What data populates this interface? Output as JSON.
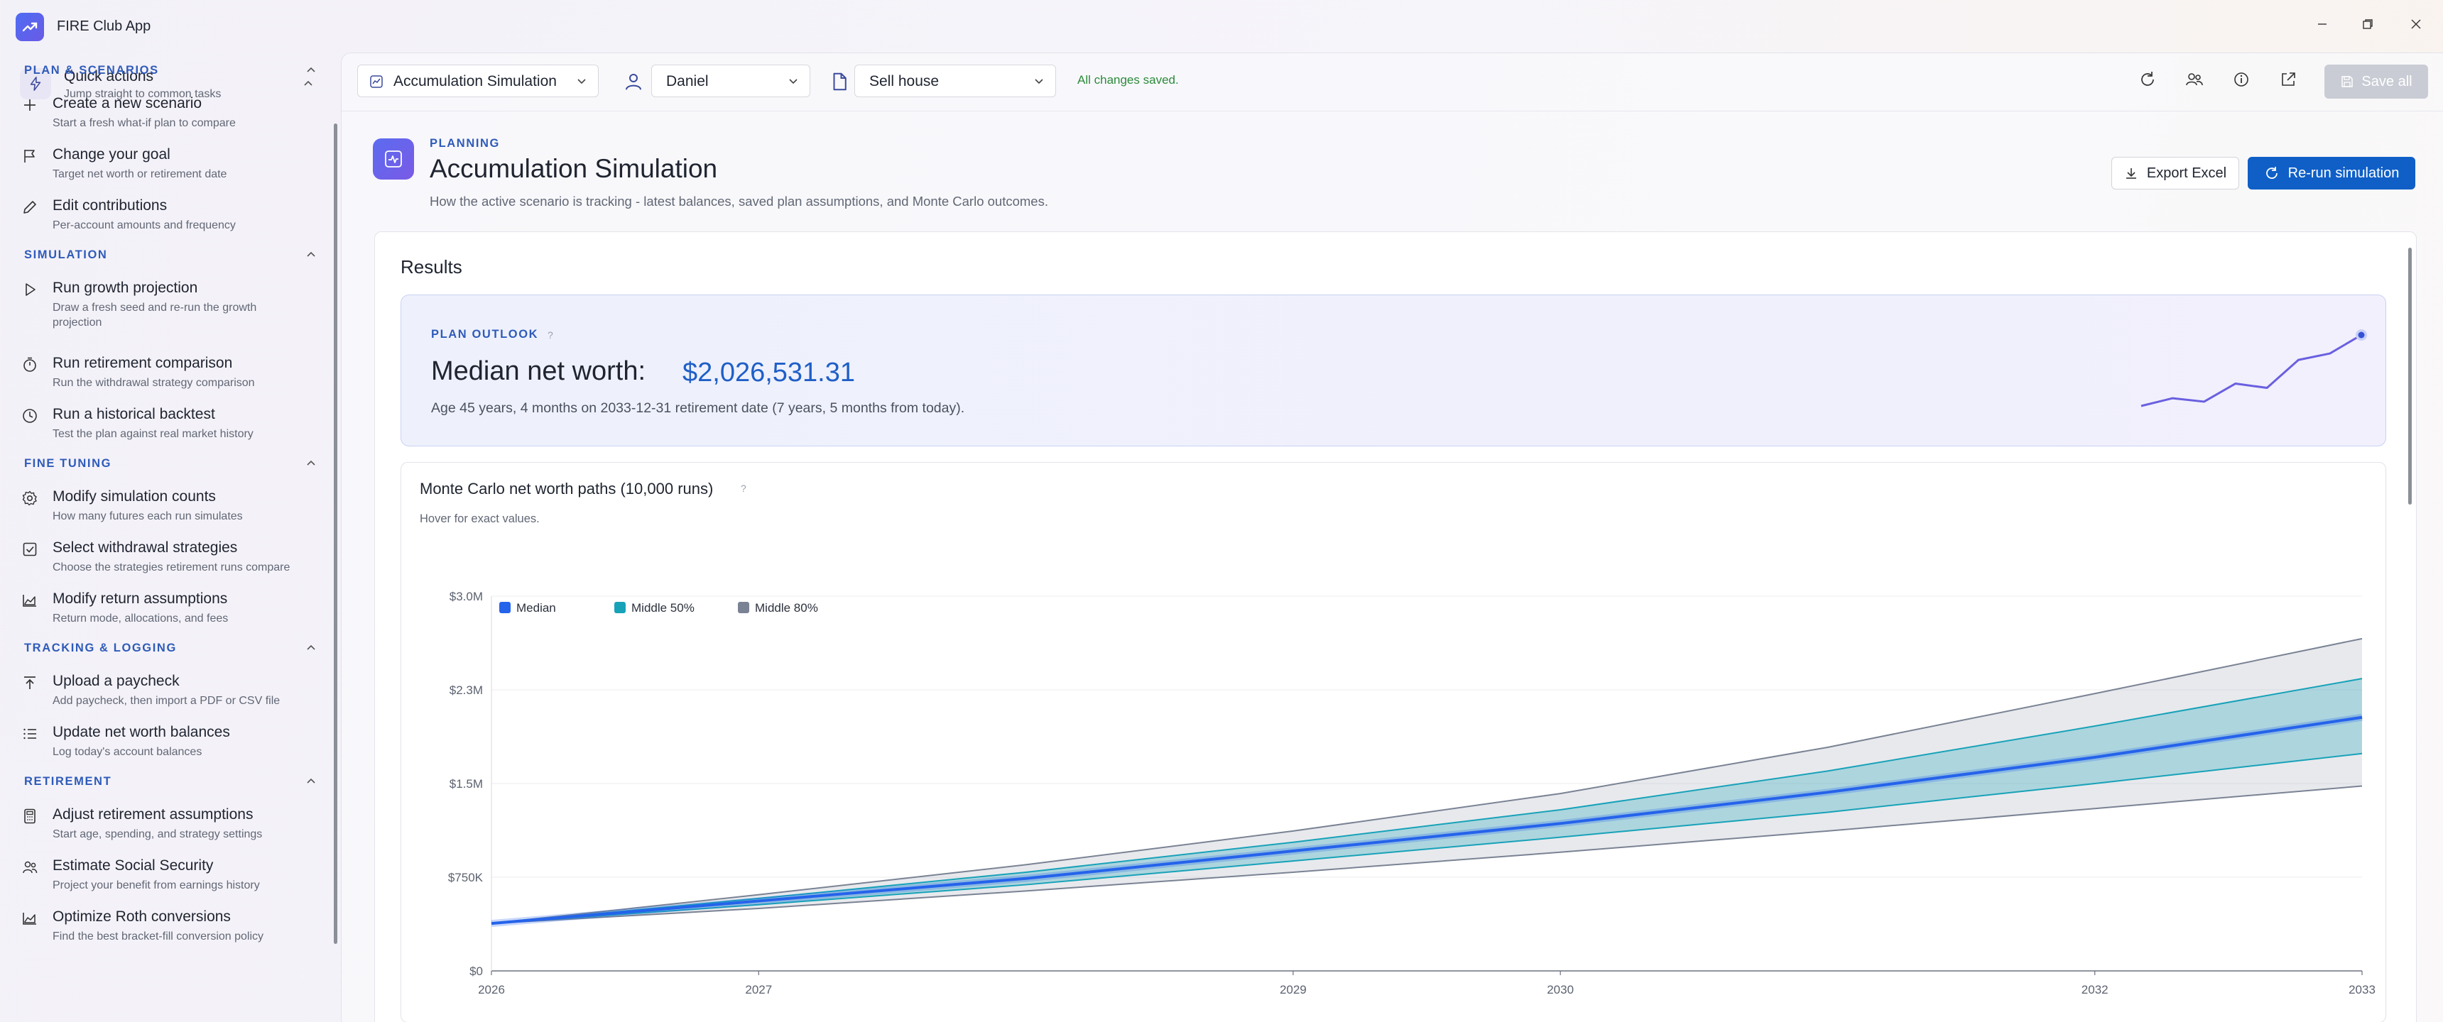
{
  "app": {
    "title": "FIRE Club App"
  },
  "sidebar": {
    "quick_actions": {
      "title": "Quick actions",
      "subtitle": "Jump straight to common tasks"
    },
    "sections": [
      {
        "heading": "PLAN & SCENARIOS",
        "items": [
          {
            "title": "Create a new scenario",
            "subtitle": "Start a fresh what-if plan to compare",
            "icon": "plus-icon"
          },
          {
            "title": "Change your goal",
            "subtitle": "Target net worth or retirement date",
            "icon": "flag-icon"
          },
          {
            "title": "Edit contributions",
            "subtitle": "Per-account amounts and frequency",
            "icon": "pencil-icon"
          }
        ]
      },
      {
        "heading": "SIMULATION",
        "items": [
          {
            "title": "Run growth projection",
            "subtitle": "Draw a fresh seed and re-run the growth projection",
            "icon": "play-icon"
          },
          {
            "title": "Run retirement comparison",
            "subtitle": "Run the withdrawal strategy comparison",
            "icon": "timer-icon"
          },
          {
            "title": "Run a historical backtest",
            "subtitle": "Test the plan against real market history",
            "icon": "clock-icon"
          }
        ]
      },
      {
        "heading": "FINE TUNING",
        "items": [
          {
            "title": "Modify simulation counts",
            "subtitle": "How many futures each run simulates",
            "icon": "gear-icon"
          },
          {
            "title": "Select withdrawal strategies",
            "subtitle": "Choose the strategies retirement runs compare",
            "icon": "checkbox-icon"
          },
          {
            "title": "Modify return assumptions",
            "subtitle": "Return mode, allocations, and fees",
            "icon": "area-chart-icon"
          }
        ]
      },
      {
        "heading": "TRACKING & LOGGING",
        "items": [
          {
            "title": "Upload a paycheck",
            "subtitle": "Add paycheck, then import a PDF or CSV file",
            "icon": "upload-icon"
          },
          {
            "title": "Update net worth balances",
            "subtitle": "Log today's account balances",
            "icon": "list-icon"
          }
        ]
      },
      {
        "heading": "RETIREMENT",
        "items": [
          {
            "title": "Adjust retirement assumptions",
            "subtitle": "Start age, spending, and strategy settings",
            "icon": "calculator-icon"
          },
          {
            "title": "Estimate Social Security",
            "subtitle": "Project your benefit from earnings history",
            "icon": "people-icon"
          },
          {
            "title": "Optimize Roth conversions",
            "subtitle": "Find the best bracket-fill conversion policy",
            "icon": "area-chart-icon"
          }
        ]
      }
    ]
  },
  "toolbar": {
    "view": "Accumulation Simulation",
    "person": "Daniel",
    "scenario": "Sell house",
    "status": "All changes saved.",
    "save_all": "Save all"
  },
  "header": {
    "eyebrow": "PLANNING",
    "title": "Accumulation Simulation",
    "subtitle": "How the active scenario is tracking - latest balances, saved plan assumptions, and Monte Carlo outcomes.",
    "export_label": "Export Excel",
    "rerun_label": "Re-run simulation"
  },
  "results": {
    "title": "Results",
    "outlook": {
      "eyebrow": "PLAN OUTLOOK",
      "help": "?",
      "median_label": "Median net worth:",
      "median_value": "$2,026,531.31",
      "subtitle": "Age 45 years, 4 months on 2033-12-31 retirement date (7 years, 5 months from today)."
    },
    "monte_carlo": {
      "title": "Monte Carlo net worth paths (10,000 runs)",
      "help": "?",
      "subtitle": "Hover for exact values."
    }
  },
  "colors": {
    "accent": "#0f5fc7",
    "median": "#2563eb",
    "middle50": "#17a2b8",
    "middle80": "#7a8394"
  },
  "chart_data": {
    "type": "area",
    "x": [
      2026,
      2027,
      2028,
      2029,
      2030,
      2031,
      2032,
      2033
    ],
    "xticks": [
      "2026",
      "2027",
      "2029",
      "2030",
      "2032",
      "2033"
    ],
    "xtick_values": [
      2026,
      2027,
      2029,
      2030,
      2032,
      2033
    ],
    "yticks": [
      "$0",
      "$750K",
      "$1.5M",
      "$2.3M",
      "$3.0M"
    ],
    "ytick_values": [
      0,
      750000,
      1500000,
      2250000,
      3000000
    ],
    "ylim": [
      0,
      3000000
    ],
    "xlim": [
      2026,
      2033
    ],
    "legend": [
      "Median",
      "Middle 50%",
      "Middle 80%"
    ],
    "legend_position": "top-left",
    "series": [
      {
        "name": "Median",
        "values": [
          380000,
          560000,
          740000,
          960000,
          1180000,
          1430000,
          1710000,
          2030000
        ]
      },
      {
        "name": "Middle 50%",
        "lower": [
          380000,
          530000,
          690000,
          880000,
          1070000,
          1270000,
          1500000,
          1740000
        ],
        "upper": [
          380000,
          580000,
          790000,
          1030000,
          1290000,
          1600000,
          1960000,
          2340000
        ]
      },
      {
        "name": "Middle 80%",
        "lower": [
          380000,
          500000,
          640000,
          790000,
          950000,
          1120000,
          1300000,
          1480000
        ],
        "upper": [
          380000,
          610000,
          850000,
          1120000,
          1420000,
          1790000,
          2220000,
          2660000
        ]
      }
    ],
    "grid": true
  },
  "sparkline": [
    380000,
    560000,
    480000,
    900000,
    800000,
    1450000,
    1600000,
    2030000
  ]
}
